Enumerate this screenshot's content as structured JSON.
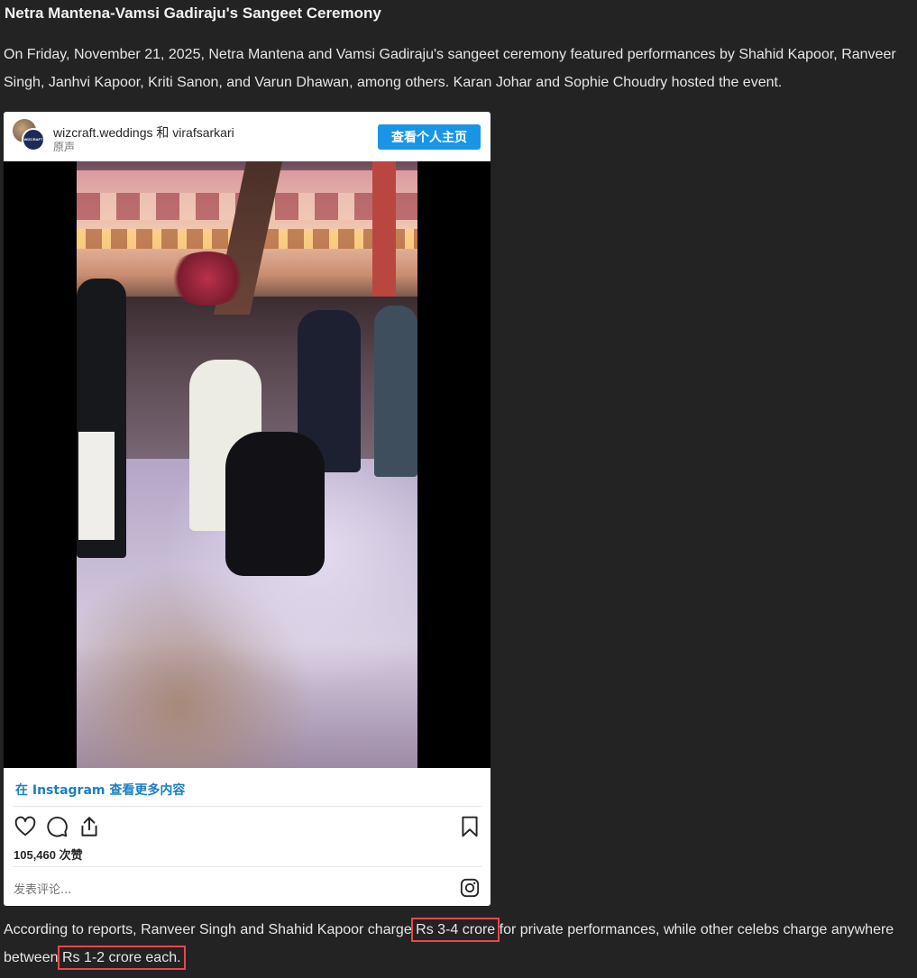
{
  "article": {
    "headline": "Netra Mantena-Vamsi Gadiraju's Sangeet Ceremony",
    "intro": "On Friday, November 21, 2025, Netra Mantena and Vamsi Gadiraju's sangeet ceremony featured performances by Shahid Kapoor, Ranveer Singh, Janhvi Kapoor, Kriti Sanon, and Varun Dhawan, among others. Karan Johar and Sophie Choudry hosted the event.",
    "body_before": "According to reports, Ranveer Singh and Shahid Kapoor charge ",
    "highlight_1": "Rs 3-4 crore",
    "body_middle": " for private performances, while other celebs charge anywhere between ",
    "highlight_2": "Rs 1-2 crore each.",
    "highlight_color": "#e8474a"
  },
  "embed": {
    "avatar_text": "WIZCRAFT",
    "account": "wizcraft.weddings 和 virafsarkari",
    "audio": "原声",
    "view_profile_label": "查看个人主页",
    "view_more_label": "在 Instagram 查看更多内容",
    "likes": "105,460 次赞",
    "comment_placeholder": "发表评论...",
    "icons": [
      "heart-icon",
      "comment-icon",
      "share-icon",
      "bookmark-icon",
      "instagram-icon"
    ],
    "accent_color": "#1a95e6"
  }
}
